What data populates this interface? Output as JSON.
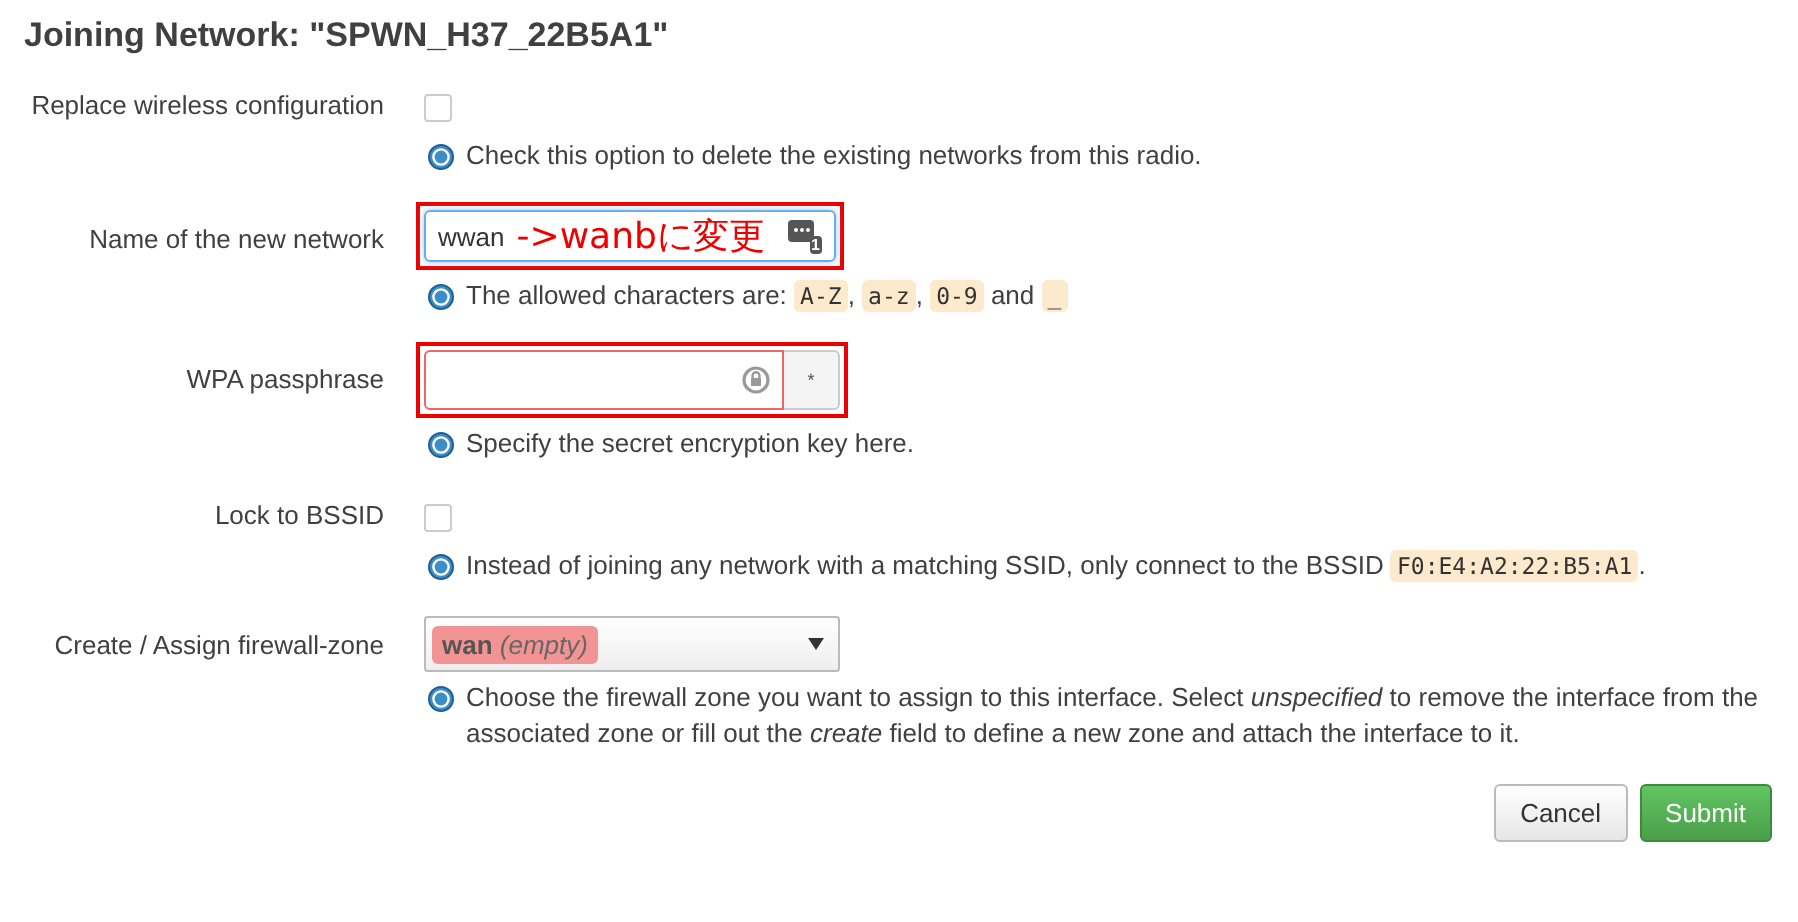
{
  "title": "Joining Network: \"SPWN_H37_22B5A1\"",
  "rows": [
    {
      "kind": "checkbox",
      "label": "Replace wireless configuration",
      "checked": false,
      "help": [
        {
          "kind": "text",
          "t": "Check this option to delete the existing networks from this radio."
        }
      ]
    },
    {
      "kind": "text",
      "label": "Name of the new network",
      "value": "wwan",
      "annotation": "->wanbに変更",
      "badge": "1",
      "marked": true,
      "help": [
        {
          "kind": "text",
          "t": "The allowed characters are: "
        },
        {
          "kind": "code",
          "t": "A-Z"
        },
        {
          "kind": "text",
          "t": ", "
        },
        {
          "kind": "code",
          "t": "a-z"
        },
        {
          "kind": "text",
          "t": ", "
        },
        {
          "kind": "code",
          "t": "0-9"
        },
        {
          "kind": "text",
          "t": " and "
        },
        {
          "kind": "code",
          "t": "_"
        }
      ]
    },
    {
      "kind": "password",
      "label": "WPA passphrase",
      "button": "*",
      "marked": true,
      "help": [
        {
          "kind": "text",
          "t": "Specify the secret encryption key here."
        }
      ]
    },
    {
      "kind": "checkbox",
      "label": "Lock to BSSID",
      "checked": false,
      "help": [
        {
          "kind": "text",
          "t": "Instead of joining any network with a matching SSID, only connect to the BSSID "
        },
        {
          "kind": "code",
          "t": "F0:E4:A2:22:B5:A1"
        },
        {
          "kind": "text",
          "t": "."
        }
      ]
    },
    {
      "kind": "select",
      "label": "Create / Assign firewall-zone",
      "zone": "wan",
      "zone_note": "(empty)",
      "help": [
        {
          "kind": "text",
          "t": "Choose the firewall zone you want to assign to this interface. Select "
        },
        {
          "kind": "em",
          "t": "unspecified"
        },
        {
          "kind": "text",
          "t": " to remove the interface from the associated zone or fill out the "
        },
        {
          "kind": "em",
          "t": "create"
        },
        {
          "kind": "text",
          "t": " field to define a new zone and attach the interface to it."
        }
      ]
    }
  ],
  "buttons": [
    {
      "kind": "cancel",
      "label": "Cancel"
    },
    {
      "kind": "submit",
      "label": "Submit"
    }
  ]
}
